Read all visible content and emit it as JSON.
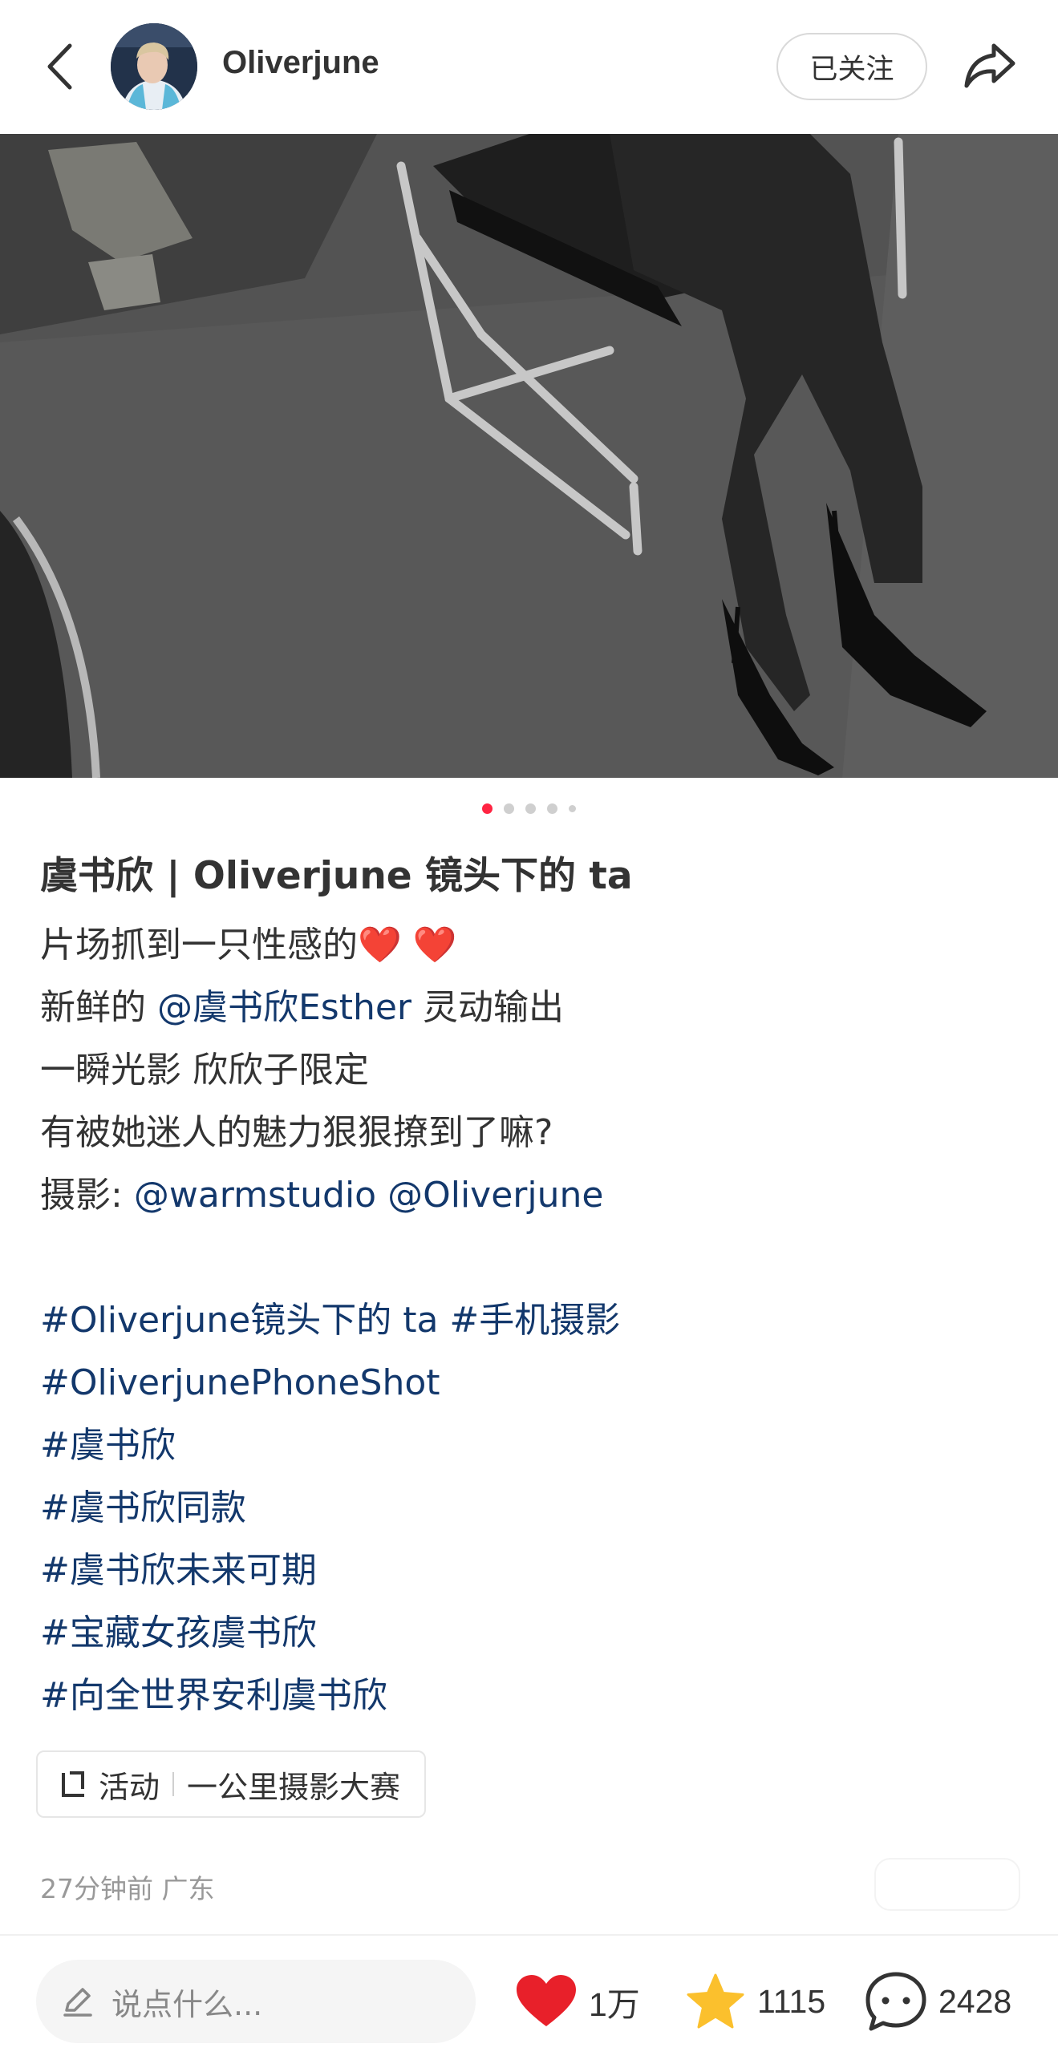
{
  "header": {
    "username": "Oliverjune",
    "follow_label": "已关注"
  },
  "gallery": {
    "total_images": 5,
    "active_index": 0
  },
  "post": {
    "title": "虞书欣 | Oliverjune 镜头下的 ta",
    "line1_text": "片场抓到一只性感的",
    "line1_emoji": "❤️ ❤️",
    "line2_pre": "新鲜的 ",
    "line2_mention": "@虞书欣Esther",
    "line2_post": " 灵动输出",
    "line3": "一瞬光影 欣欣子限定",
    "line4": "有被她迷人的魅力狠狠撩到了嘛?",
    "line5_label": "摄影:",
    "mention_a": "@warmstudio",
    "mention_b": "@Oliverjune",
    "tag_a": "#Oliverjune镜头下的 ta",
    "tag_b": "#手机摄影",
    "tags": [
      "#OliverjunePhoneShot",
      "#虞书欣",
      "#虞书欣同款",
      "#虞书欣未来可期",
      "#宝藏女孩虞书欣",
      "#向全世界安利虞书欣"
    ]
  },
  "activity": {
    "label": "活动",
    "name": "一公里摄影大赛"
  },
  "meta": {
    "time_location": "27分钟前 广东"
  },
  "bottom_bar": {
    "comment_placeholder": "说点什么...",
    "likes": "1万",
    "collects": "1115",
    "comments": "2428"
  },
  "colors": {
    "accent": "#ff2442",
    "link": "#13386c",
    "like_heart": "#e8202a",
    "star": "#fbc02d"
  },
  "icons": [
    "back-arrow-icon",
    "share-icon",
    "activity-icon",
    "pen-icon",
    "heart-icon",
    "star-icon",
    "comment-icon"
  ]
}
